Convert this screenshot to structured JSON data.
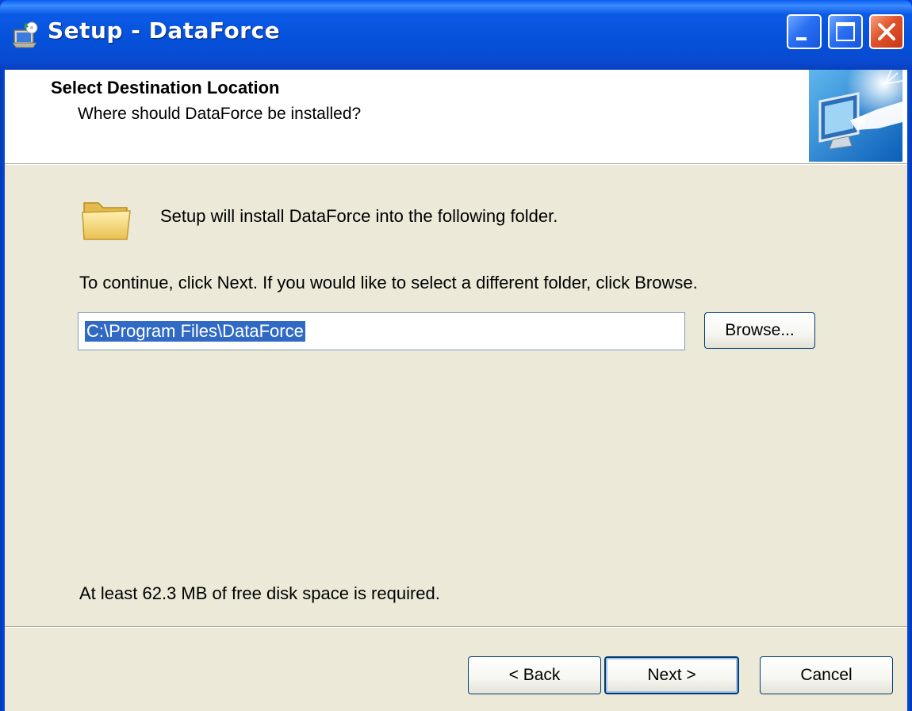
{
  "window": {
    "title": "Setup - DataForce",
    "icon": "setup-icon",
    "controls": [
      "minimize-icon",
      "maximize-icon",
      "close-icon"
    ]
  },
  "header": {
    "title": "Select Destination Location",
    "subtitle": "Where should DataForce be installed?",
    "image": "computer-install-icon"
  },
  "body": {
    "intro": "Setup will install DataForce into the following folder.",
    "instruction": "To continue, click Next. If you would like to select a different folder, click Browse.",
    "path_value": "C:\\Program Files\\DataForce",
    "browse_label": "Browse...",
    "disk_space": "At least 62.3 MB of free disk space is required."
  },
  "footer": {
    "back_label": "< Back",
    "next_label": "Next >",
    "cancel_label": "Cancel"
  },
  "colors": {
    "titlebar": "#0550d8",
    "dialog_bg": "#ece9d8",
    "selection": "#316ac5"
  }
}
